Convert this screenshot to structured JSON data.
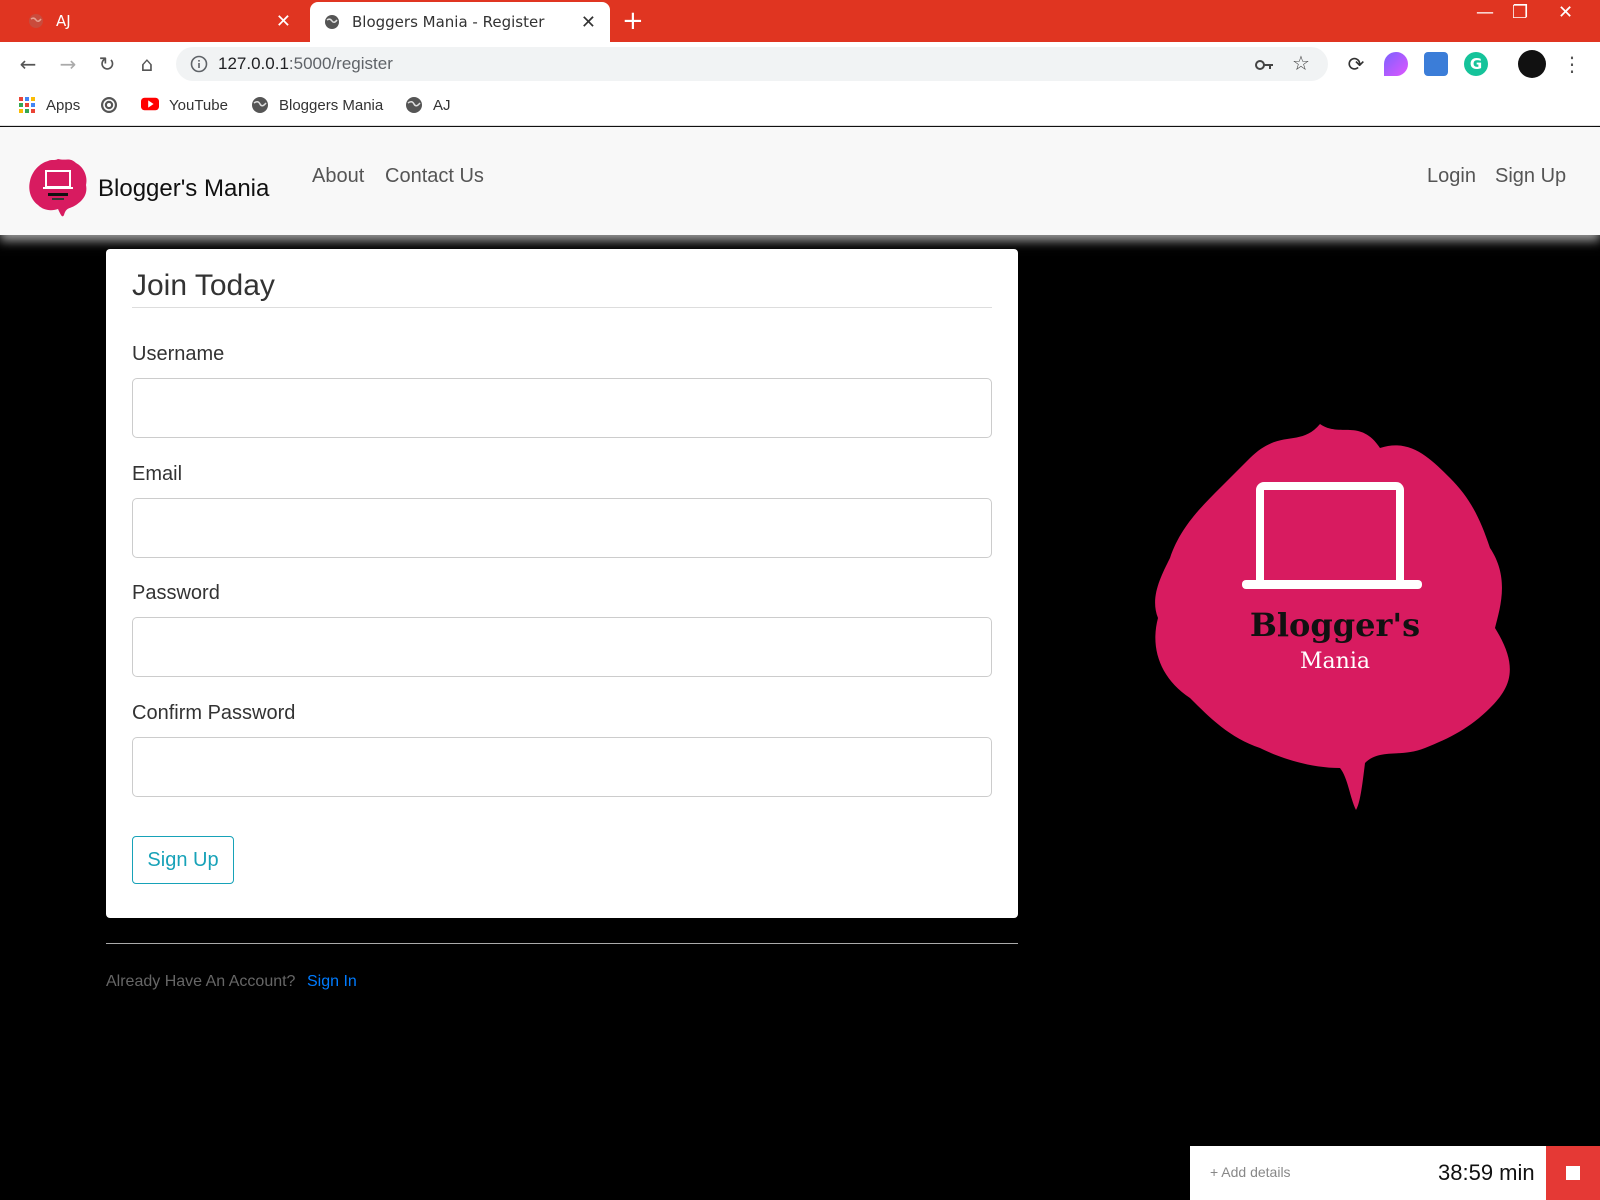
{
  "browser": {
    "tabs": [
      {
        "title": "AJ",
        "active": false
      },
      {
        "title": "Bloggers Mania - Register",
        "active": true
      }
    ],
    "url_host": "127.0.0.1",
    "url_rest": ":5000/register",
    "bookmarks": [
      {
        "label": "Apps",
        "icon": "apps-grid-icon"
      },
      {
        "label": "",
        "icon": "spiral-icon"
      },
      {
        "label": "YouTube",
        "icon": "youtube-icon"
      },
      {
        "label": "Bloggers Mania",
        "icon": "globe-icon"
      },
      {
        "label": "AJ",
        "icon": "globe-icon"
      }
    ],
    "accent": "#e03521"
  },
  "site": {
    "brand": "Blogger's Mania",
    "nav_left": [
      "About",
      "Contact Us"
    ],
    "nav_right": [
      "Login",
      "Sign Up"
    ],
    "brand_color": "#d81b60"
  },
  "form": {
    "title": "Join Today",
    "fields": [
      {
        "label": "Username",
        "value": ""
      },
      {
        "label": "Email",
        "value": ""
      },
      {
        "label": "Password",
        "value": ""
      },
      {
        "label": "Confirm Password",
        "value": ""
      }
    ],
    "submit": "Sign Up",
    "submit_color": "#17a2b8"
  },
  "footer": {
    "prompt": "Already Have An Account?",
    "link": "Sign In"
  },
  "logo": {
    "line1": "Blogger's",
    "line2": "Mania"
  },
  "timer": {
    "add_details": "+ Add details",
    "time": "38:59 min"
  }
}
